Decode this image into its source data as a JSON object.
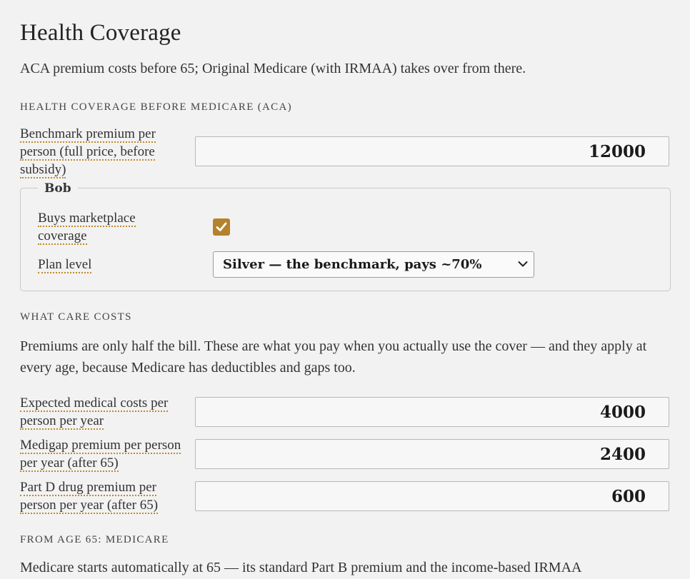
{
  "page": {
    "title": "Health Coverage",
    "intro": "ACA premium costs before 65; Original Medicare (with IRMAA) takes over from there."
  },
  "aca_section": {
    "heading": "Health coverage before Medicare (ACA)",
    "benchmark_label": "Benchmark premium per person (full price, before subsidy)",
    "benchmark_value": "12000",
    "person": {
      "name": "Bob",
      "buys_label": "Buys marketplace coverage",
      "buys_checked": true,
      "plan_label": "Plan level",
      "plan_selected": "Silver — the benchmark, pays ~70%"
    }
  },
  "care_section": {
    "heading": "What care costs",
    "description": "Premiums are only half the bill. These are what you pay when you actually use the cover — and they apply at every age, because Medicare has deductibles and gaps too.",
    "fields": [
      {
        "label": "Expected medical costs per person per year",
        "value": "4000"
      },
      {
        "label": "Medigap premium per person per year (after 65)",
        "value": "2400"
      },
      {
        "label": "Part D drug premium per person per year (after 65)",
        "value": "600"
      }
    ]
  },
  "medicare_section": {
    "heading": "From age 65: Medicare",
    "description": "Medicare starts automatically at 65 — its standard Part B premium and the income-based IRMAA"
  },
  "colors": {
    "accent": "#b5822c",
    "background": "#f2f2f2",
    "underline": "#c08a2b"
  },
  "icons": {
    "checkbox": "checkmark-icon",
    "select": "chevron-down-icon"
  }
}
